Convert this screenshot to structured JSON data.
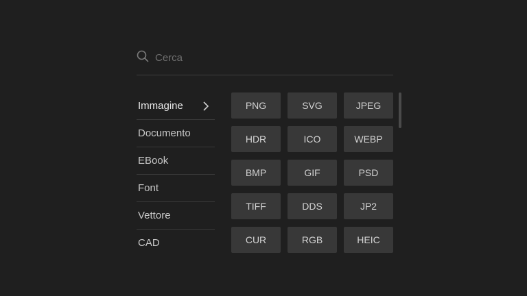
{
  "search": {
    "placeholder": "Cerca",
    "icon": "search-icon"
  },
  "categories": [
    {
      "label": "Immagine",
      "active": true
    },
    {
      "label": "Documento",
      "active": false
    },
    {
      "label": "EBook",
      "active": false
    },
    {
      "label": "Font",
      "active": false
    },
    {
      "label": "Vettore",
      "active": false
    },
    {
      "label": "CAD",
      "active": false
    }
  ],
  "formats": [
    "PNG",
    "SVG",
    "JPEG",
    "HDR",
    "ICO",
    "WEBP",
    "BMP",
    "GIF",
    "PSD",
    "TIFF",
    "DDS",
    "JP2",
    "CUR",
    "RGB",
    "HEIC"
  ],
  "colors": {
    "background": "#1f1f1f",
    "button": "#383838",
    "text": "#d6d6d6",
    "divider": "#3a3a3a"
  }
}
